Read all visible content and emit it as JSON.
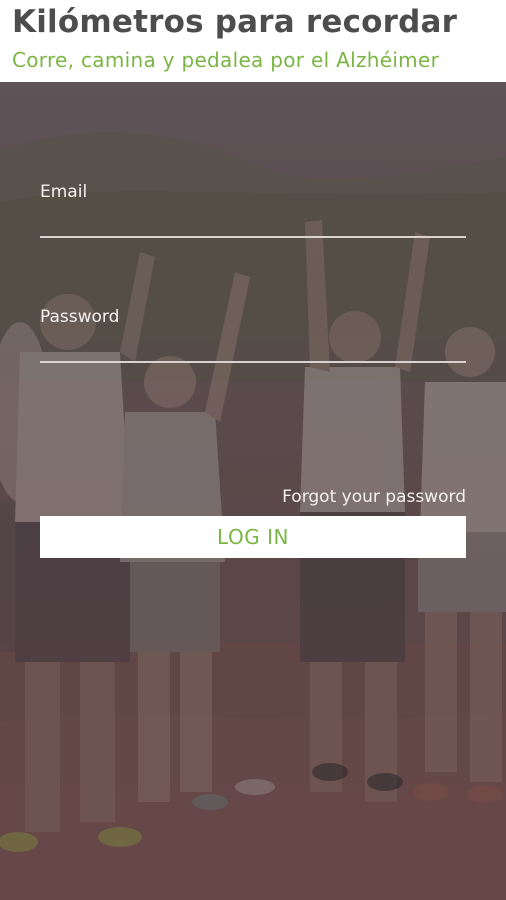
{
  "app": {
    "title": "Kilómetros para recordar",
    "subtitle": "Corre, camina y pedalea por el Alzhéimer"
  },
  "colors": {
    "title": "#4d4d4d",
    "accent": "#7bb545",
    "overlay": "#5a4a4c"
  },
  "login": {
    "email_label": "Email",
    "email_value": "",
    "password_label": "Password",
    "password_value": "",
    "forgot_label": "Forgot your password",
    "login_button_label": "LOG IN"
  }
}
